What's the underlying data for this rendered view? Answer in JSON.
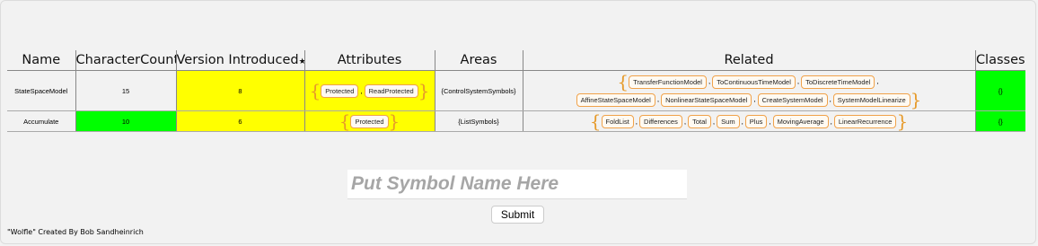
{
  "table": {
    "headers": {
      "name": "Name",
      "character_count": "CharacterCount",
      "version_introduced": "Version Introduced",
      "version_star": "★",
      "attributes": "Attributes",
      "areas": "Areas",
      "related": "Related",
      "classes": "Classes"
    },
    "rows": [
      {
        "name": "StateSpaceModel",
        "character_count": "15",
        "version_introduced": "8",
        "attributes": [
          "Protected",
          "ReadProtected"
        ],
        "areas": "{ControlSystemSymbols}",
        "related_line1": [
          "TransferFunctionModel",
          "ToContinuousTimeModel",
          "ToDiscreteTimeModel"
        ],
        "related_line2": [
          "AffineStateSpaceModel",
          "NonlinearStateSpaceModel",
          "CreateSystemModel",
          "SystemModelLinearize"
        ],
        "classes": "{}"
      },
      {
        "name": "Accumulate",
        "character_count": "10",
        "version_introduced": "6",
        "attributes": [
          "Protected"
        ],
        "areas": "{ListSymbols}",
        "related_line1": [
          "FoldList",
          "Differences",
          "Total",
          "Sum",
          "Plus",
          "MovingAverage",
          "LinearRecurrence"
        ],
        "classes": "{}"
      }
    ]
  },
  "search": {
    "placeholder": "Put Symbol Name Here",
    "value": ""
  },
  "submit_label": "Submit",
  "credit": "\"Wolfle\" Created By Bob Sandheinrich",
  "colors": {
    "match": "#00ff00",
    "partial": "#ffff00",
    "chip_border": "#f0a24a"
  }
}
